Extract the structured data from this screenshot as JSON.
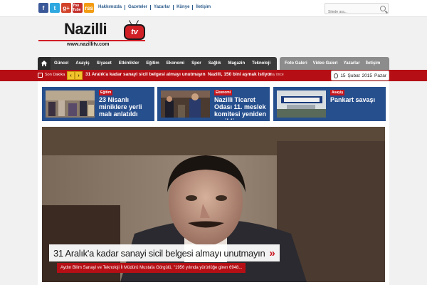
{
  "topbar": {
    "social": {
      "facebook": "f",
      "twitter": "t",
      "googleplus": "g+",
      "youtube": "You Tube",
      "rss": "rss"
    },
    "links": [
      "Hakkımızda",
      "Gazeteler",
      "Yazarlar",
      "Künye",
      "İletişim"
    ],
    "search_placeholder": "Sitede ara..."
  },
  "logo": {
    "name": "Nazilli",
    "badge": "tv",
    "url": "www.nazillitv.com"
  },
  "nav": {
    "items": [
      "Güncel",
      "Asayiş",
      "Siyaset",
      "Etkinlikler",
      "Eğitim",
      "Ekonomi",
      "Spor",
      "Sağlık",
      "Magazin",
      "Teknoloji"
    ],
    "secondary": [
      "Foto Galeri",
      "Video Galeri",
      "Yazarlar",
      "İletişim"
    ]
  },
  "ticker": {
    "label": "Son Dakika",
    "prev": "‹",
    "next": "›",
    "news": [
      {
        "text": "31 Aralık'a kadar sanayi sicil belgesi almayı unutmayın",
        "time": ""
      },
      {
        "text": "Nazilli, 150 bini aşmak istiyor",
        "time": "2 ay önce"
      }
    ],
    "date": {
      "day": "15",
      "month": "Şubat",
      "year": "2015",
      "weekday": "Pazar"
    }
  },
  "cards": [
    {
      "category": "Eğitim",
      "title": "23 Nisanlı miniklere yerli malı anlatıldı"
    },
    {
      "category": "Ekonomi",
      "title": "Nazilli Ticaret Odası 11. meslek komitesi yeniden seçildi"
    },
    {
      "category": "Asayiş",
      "title": "Pankart savaşı"
    }
  ],
  "hero": {
    "headline": "31 Aralık'a kadar sanayi sicil belgesi almayı unutmayın",
    "more": "»",
    "summary": "Aydın Bilim Sanayi ve Teknoloji İl Müdürü Mustafa Görgülü, \"1956 yılında yürürlüğe giren 6948..."
  },
  "colors": {
    "brand_red": "#b50f15",
    "card_blue": "#264f8e",
    "nav_dark": "#3b3b3b",
    "ticker_yellow": "#f2c42c"
  }
}
